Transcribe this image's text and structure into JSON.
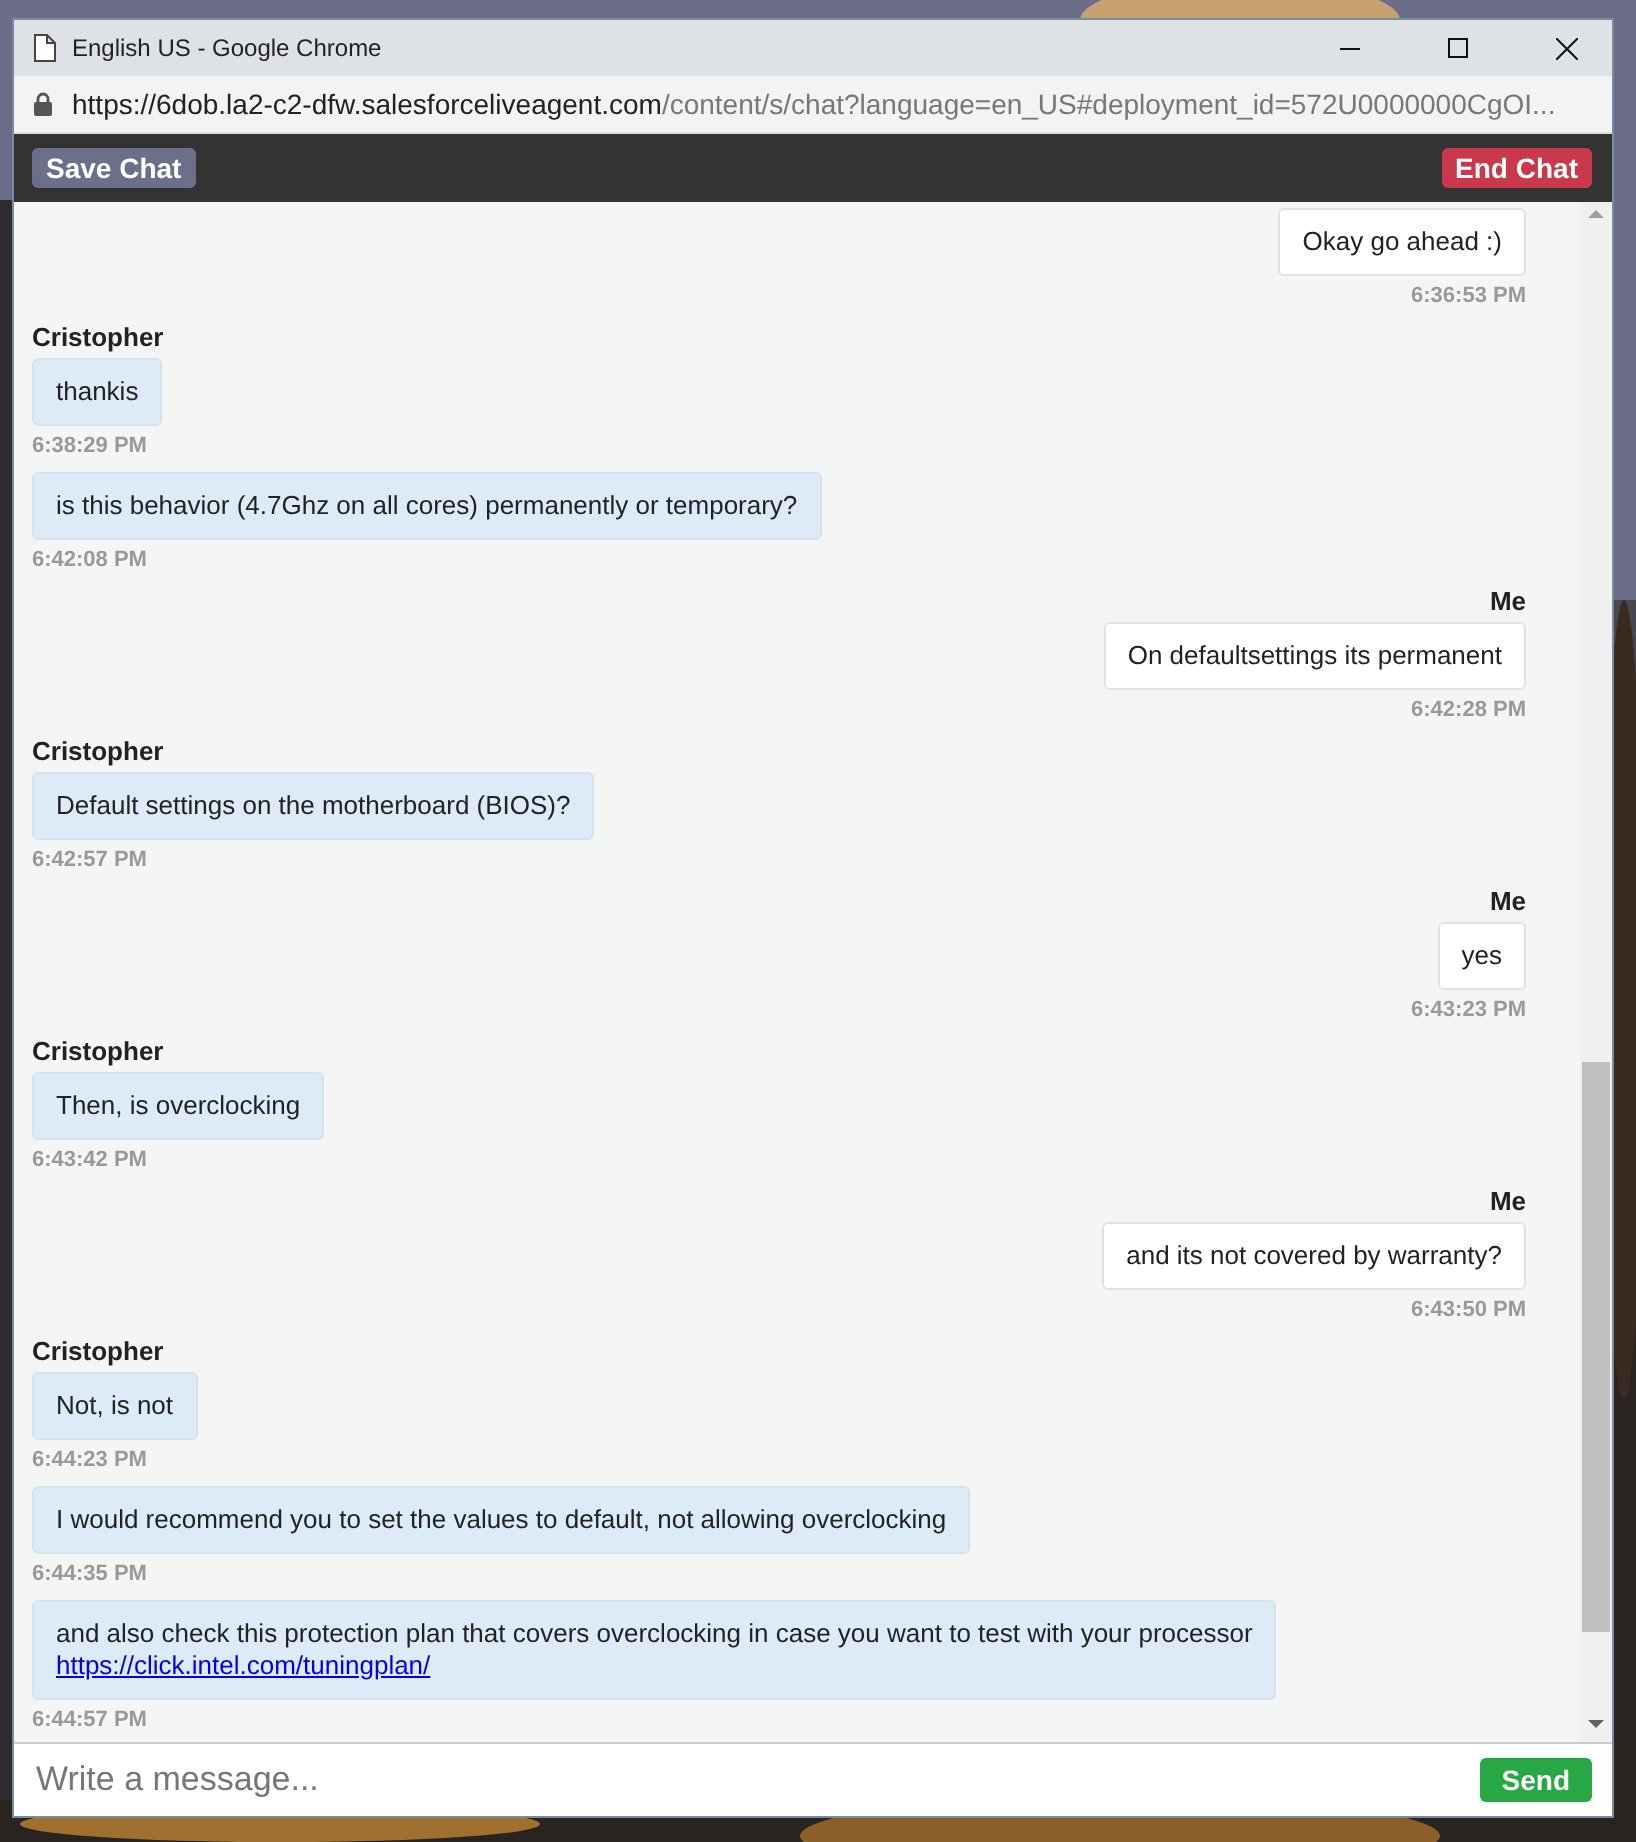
{
  "window": {
    "title": "English US - Google Chrome"
  },
  "address_bar": {
    "host": "https://6dob.la2-c2-dfw.salesforceliveagent.com",
    "path": "/content/s/chat?language=en_US#deployment_id=572U0000000CgOI..."
  },
  "toolbar": {
    "save_button": "Save Chat",
    "end_button": "End Chat"
  },
  "messages": [
    {
      "kind": "me",
      "text": "Okay go ahead :)",
      "time": "6:36:53 PM"
    },
    {
      "kind": "agent",
      "sender": "Cristopher",
      "text": "thankis",
      "time": "6:38:29 PM"
    },
    {
      "kind": "agent",
      "text": "is this behavior (4.7Ghz on all cores) permanently or temporary?",
      "time": "6:42:08 PM"
    },
    {
      "kind": "me",
      "sender": "Me",
      "text": "On defaultsettings its permanent",
      "time": "6:42:28 PM"
    },
    {
      "kind": "agent",
      "sender": "Cristopher",
      "text": "Default settings on the motherboard (BIOS)?",
      "time": "6:42:57 PM"
    },
    {
      "kind": "me",
      "sender": "Me",
      "text": "yes",
      "time": "6:43:23 PM"
    },
    {
      "kind": "agent",
      "sender": "Cristopher",
      "text": "Then, is overclocking",
      "time": "6:43:42 PM"
    },
    {
      "kind": "me",
      "sender": "Me",
      "text": "and its not covered by warranty?",
      "time": "6:43:50 PM"
    },
    {
      "kind": "agent",
      "sender": "Cristopher",
      "text": "Not, is not",
      "time": "6:44:23 PM"
    },
    {
      "kind": "agent",
      "text": "I would recommend you to set the values to default, not allowing overclocking",
      "time": "6:44:35 PM"
    },
    {
      "kind": "agent",
      "text": "and also check this protection plan that covers overclocking in case you want to test with your processor",
      "link": "https://click.intel.com/tuningplan/",
      "time": "6:44:57 PM"
    }
  ],
  "composer": {
    "placeholder": "Write a message...",
    "send_button": "Send"
  }
}
